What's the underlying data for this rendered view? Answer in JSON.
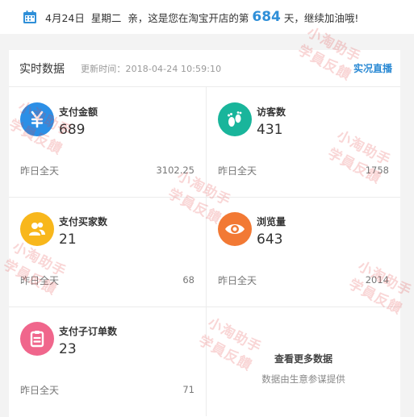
{
  "topbar": {
    "date": "4月24日",
    "weekday": "星期二",
    "greeting_prefix": "亲，这是您在淘宝开店的第",
    "days": "684",
    "greeting_suffix": "天，继续加油哦!"
  },
  "panel": {
    "title": "实时数据",
    "update_time": "更新时间：2018-04-24 10:59:10",
    "live_link": "实况直播"
  },
  "metrics": [
    {
      "label": "支付金额",
      "value": "689",
      "foot": "昨日全天",
      "yesterday": "3102.25",
      "icon": "yuan-icon",
      "color": "#2c8fe6"
    },
    {
      "label": "访客数",
      "value": "431",
      "foot": "昨日全天",
      "yesterday": "1758",
      "icon": "footprint-icon",
      "color": "#19b59b"
    },
    {
      "label": "支付买家数",
      "value": "21",
      "foot": "昨日全天",
      "yesterday": "68",
      "icon": "buyers-icon",
      "color": "#f8b71c"
    },
    {
      "label": "浏览量",
      "value": "643",
      "foot": "昨日全天",
      "yesterday": "2014",
      "icon": "eye-icon",
      "color": "#f27934"
    },
    {
      "label": "支付子订单数",
      "value": "23",
      "foot": "昨日全天",
      "yesterday": "71",
      "icon": "order-icon",
      "color": "#f0668c"
    }
  ],
  "more": {
    "link": "查看更多数据",
    "sub": "数据由生意参谋提供"
  },
  "watermark": {
    "line1": "小淘助手",
    "line2": "学員反饋"
  }
}
